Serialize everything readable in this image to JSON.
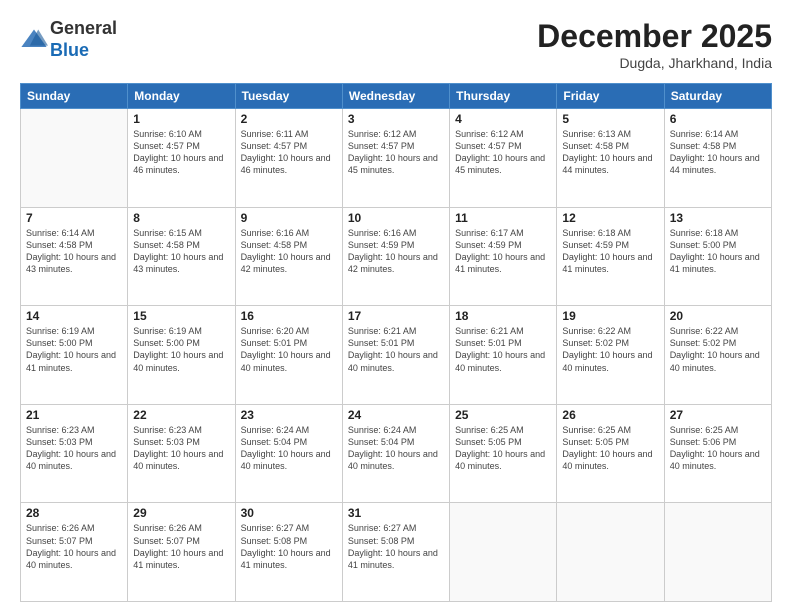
{
  "logo": {
    "general": "General",
    "blue": "Blue"
  },
  "header": {
    "month": "December 2025",
    "location": "Dugda, Jharkhand, India"
  },
  "weekdays": [
    "Sunday",
    "Monday",
    "Tuesday",
    "Wednesday",
    "Thursday",
    "Friday",
    "Saturday"
  ],
  "weeks": [
    [
      {
        "day": "",
        "sunrise": "",
        "sunset": "",
        "daylight": ""
      },
      {
        "day": "1",
        "sunrise": "Sunrise: 6:10 AM",
        "sunset": "Sunset: 4:57 PM",
        "daylight": "Daylight: 10 hours and 46 minutes."
      },
      {
        "day": "2",
        "sunrise": "Sunrise: 6:11 AM",
        "sunset": "Sunset: 4:57 PM",
        "daylight": "Daylight: 10 hours and 46 minutes."
      },
      {
        "day": "3",
        "sunrise": "Sunrise: 6:12 AM",
        "sunset": "Sunset: 4:57 PM",
        "daylight": "Daylight: 10 hours and 45 minutes."
      },
      {
        "day": "4",
        "sunrise": "Sunrise: 6:12 AM",
        "sunset": "Sunset: 4:57 PM",
        "daylight": "Daylight: 10 hours and 45 minutes."
      },
      {
        "day": "5",
        "sunrise": "Sunrise: 6:13 AM",
        "sunset": "Sunset: 4:58 PM",
        "daylight": "Daylight: 10 hours and 44 minutes."
      },
      {
        "day": "6",
        "sunrise": "Sunrise: 6:14 AM",
        "sunset": "Sunset: 4:58 PM",
        "daylight": "Daylight: 10 hours and 44 minutes."
      }
    ],
    [
      {
        "day": "7",
        "sunrise": "Sunrise: 6:14 AM",
        "sunset": "Sunset: 4:58 PM",
        "daylight": "Daylight: 10 hours and 43 minutes."
      },
      {
        "day": "8",
        "sunrise": "Sunrise: 6:15 AM",
        "sunset": "Sunset: 4:58 PM",
        "daylight": "Daylight: 10 hours and 43 minutes."
      },
      {
        "day": "9",
        "sunrise": "Sunrise: 6:16 AM",
        "sunset": "Sunset: 4:58 PM",
        "daylight": "Daylight: 10 hours and 42 minutes."
      },
      {
        "day": "10",
        "sunrise": "Sunrise: 6:16 AM",
        "sunset": "Sunset: 4:59 PM",
        "daylight": "Daylight: 10 hours and 42 minutes."
      },
      {
        "day": "11",
        "sunrise": "Sunrise: 6:17 AM",
        "sunset": "Sunset: 4:59 PM",
        "daylight": "Daylight: 10 hours and 41 minutes."
      },
      {
        "day": "12",
        "sunrise": "Sunrise: 6:18 AM",
        "sunset": "Sunset: 4:59 PM",
        "daylight": "Daylight: 10 hours and 41 minutes."
      },
      {
        "day": "13",
        "sunrise": "Sunrise: 6:18 AM",
        "sunset": "Sunset: 5:00 PM",
        "daylight": "Daylight: 10 hours and 41 minutes."
      }
    ],
    [
      {
        "day": "14",
        "sunrise": "Sunrise: 6:19 AM",
        "sunset": "Sunset: 5:00 PM",
        "daylight": "Daylight: 10 hours and 41 minutes."
      },
      {
        "day": "15",
        "sunrise": "Sunrise: 6:19 AM",
        "sunset": "Sunset: 5:00 PM",
        "daylight": "Daylight: 10 hours and 40 minutes."
      },
      {
        "day": "16",
        "sunrise": "Sunrise: 6:20 AM",
        "sunset": "Sunset: 5:01 PM",
        "daylight": "Daylight: 10 hours and 40 minutes."
      },
      {
        "day": "17",
        "sunrise": "Sunrise: 6:21 AM",
        "sunset": "Sunset: 5:01 PM",
        "daylight": "Daylight: 10 hours and 40 minutes."
      },
      {
        "day": "18",
        "sunrise": "Sunrise: 6:21 AM",
        "sunset": "Sunset: 5:01 PM",
        "daylight": "Daylight: 10 hours and 40 minutes."
      },
      {
        "day": "19",
        "sunrise": "Sunrise: 6:22 AM",
        "sunset": "Sunset: 5:02 PM",
        "daylight": "Daylight: 10 hours and 40 minutes."
      },
      {
        "day": "20",
        "sunrise": "Sunrise: 6:22 AM",
        "sunset": "Sunset: 5:02 PM",
        "daylight": "Daylight: 10 hours and 40 minutes."
      }
    ],
    [
      {
        "day": "21",
        "sunrise": "Sunrise: 6:23 AM",
        "sunset": "Sunset: 5:03 PM",
        "daylight": "Daylight: 10 hours and 40 minutes."
      },
      {
        "day": "22",
        "sunrise": "Sunrise: 6:23 AM",
        "sunset": "Sunset: 5:03 PM",
        "daylight": "Daylight: 10 hours and 40 minutes."
      },
      {
        "day": "23",
        "sunrise": "Sunrise: 6:24 AM",
        "sunset": "Sunset: 5:04 PM",
        "daylight": "Daylight: 10 hours and 40 minutes."
      },
      {
        "day": "24",
        "sunrise": "Sunrise: 6:24 AM",
        "sunset": "Sunset: 5:04 PM",
        "daylight": "Daylight: 10 hours and 40 minutes."
      },
      {
        "day": "25",
        "sunrise": "Sunrise: 6:25 AM",
        "sunset": "Sunset: 5:05 PM",
        "daylight": "Daylight: 10 hours and 40 minutes."
      },
      {
        "day": "26",
        "sunrise": "Sunrise: 6:25 AM",
        "sunset": "Sunset: 5:05 PM",
        "daylight": "Daylight: 10 hours and 40 minutes."
      },
      {
        "day": "27",
        "sunrise": "Sunrise: 6:25 AM",
        "sunset": "Sunset: 5:06 PM",
        "daylight": "Daylight: 10 hours and 40 minutes."
      }
    ],
    [
      {
        "day": "28",
        "sunrise": "Sunrise: 6:26 AM",
        "sunset": "Sunset: 5:07 PM",
        "daylight": "Daylight: 10 hours and 40 minutes."
      },
      {
        "day": "29",
        "sunrise": "Sunrise: 6:26 AM",
        "sunset": "Sunset: 5:07 PM",
        "daylight": "Daylight: 10 hours and 41 minutes."
      },
      {
        "day": "30",
        "sunrise": "Sunrise: 6:27 AM",
        "sunset": "Sunset: 5:08 PM",
        "daylight": "Daylight: 10 hours and 41 minutes."
      },
      {
        "day": "31",
        "sunrise": "Sunrise: 6:27 AM",
        "sunset": "Sunset: 5:08 PM",
        "daylight": "Daylight: 10 hours and 41 minutes."
      },
      {
        "day": "",
        "sunrise": "",
        "sunset": "",
        "daylight": ""
      },
      {
        "day": "",
        "sunrise": "",
        "sunset": "",
        "daylight": ""
      },
      {
        "day": "",
        "sunrise": "",
        "sunset": "",
        "daylight": ""
      }
    ]
  ]
}
